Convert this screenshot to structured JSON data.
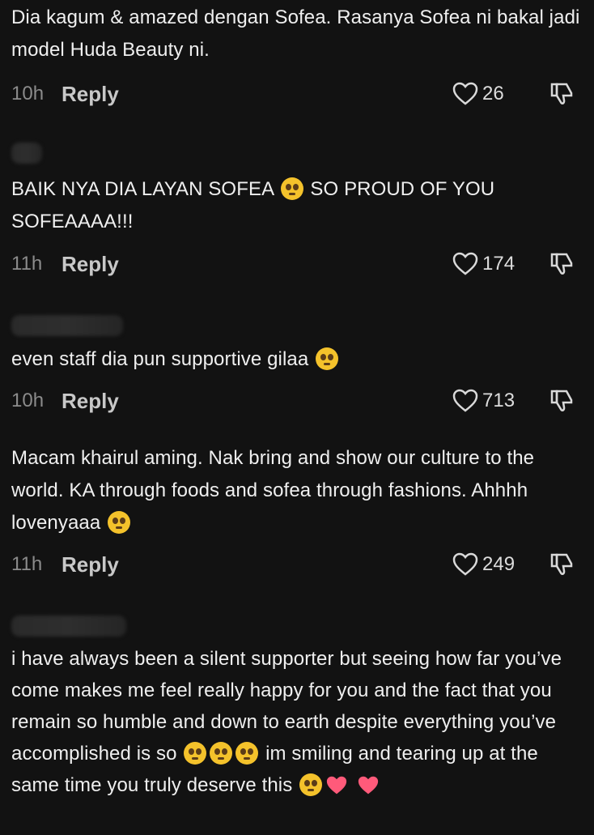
{
  "comments": [
    {
      "text": "Dia kagum & amazed dengan Sofea. Rasanya Sofea ni bakal jadi model Huda Beauty ni.",
      "time": "10h",
      "reply_label": "Reply",
      "likes": "26"
    },
    {
      "text_part1": "BAIK NYA DIA LAYAN SOFEA",
      "text_part2": "SO PROUD OF YOU SOFEAAAA!!!",
      "time": "11h",
      "reply_label": "Reply",
      "likes": "174"
    },
    {
      "text": "even staff dia pun supportive gilaa",
      "time": "10h",
      "reply_label": "Reply",
      "likes": "713"
    },
    {
      "text": "Macam khairul aming. Nak bring and show our culture to the world. KA through foods and sofea through fashions. Ahhhh lovenyaaa",
      "time": "11h",
      "reply_label": "Reply",
      "likes": "249"
    },
    {
      "text_part1": "i have always been a silent supporter but seeing how far you’ve come makes me feel really happy for you and the fact that you remain so humble and down to earth despite everything you’ve accomplished is so",
      "text_part2": "im smiling and tearing up at the same time you truly deserve this"
    }
  ],
  "icons": {
    "like": "heart-outline-icon",
    "dislike": "thumbs-down-icon",
    "emoji_pleading": "pleading-face-emoji",
    "emoji_crying": "crying-face-emoji",
    "emoji_heart_eyes": "heart-eyes-emoji",
    "emoji_heart": "red-heart-emoji"
  },
  "colors": {
    "background": "#121212",
    "text": "#efefef",
    "muted": "#8b8b8b",
    "heart": "#ff5a7a",
    "emoji_yellow": "#f4c22b"
  }
}
